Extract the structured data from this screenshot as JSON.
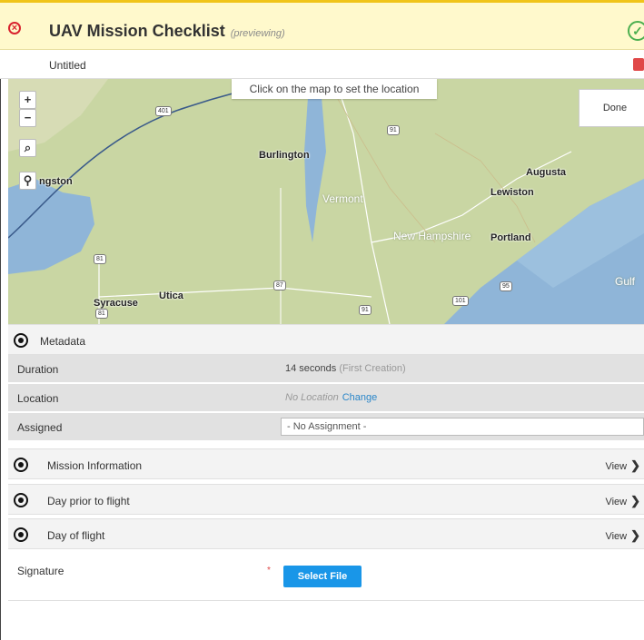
{
  "header": {
    "title": "UAV Mission Checklist",
    "preview_note": "(previewing)",
    "close_icon": "close-circle-icon",
    "check_icon": "check-circle-icon"
  },
  "subheader": {
    "name": "Untitled",
    "icon": "document-icon"
  },
  "map": {
    "banner": "Click on the map to set the location",
    "done_label": "Done",
    "controls": [
      "+",
      "−"
    ],
    "labels": {
      "burlington": "Burlington",
      "augusta": "Augusta",
      "lewiston": "Lewiston",
      "vermont": "Vermont",
      "new_hampshire": "New Hampshire",
      "portland": "Portland",
      "syracuse": "Syracuse",
      "utica": "Utica",
      "kingston": "ngston",
      "gulf": "Gulf"
    },
    "shields": [
      "401",
      "91",
      "81",
      "87",
      "95",
      "101",
      "91",
      "81"
    ]
  },
  "metadata": {
    "heading": "Metadata",
    "duration_label": "Duration",
    "duration_value": "14 seconds",
    "duration_note": "(First Creation)",
    "location_label": "Location",
    "location_value": "No Location",
    "location_change": "Change",
    "assigned_label": "Assigned",
    "assigned_value": "- No Assignment -"
  },
  "sections": [
    {
      "label": "Mission Information",
      "view": "View"
    },
    {
      "label": "Day prior to flight",
      "view": "View"
    },
    {
      "label": "Day of flight",
      "view": "View"
    }
  ],
  "signature": {
    "label": "Signature",
    "required": "*",
    "button": "Select File"
  }
}
